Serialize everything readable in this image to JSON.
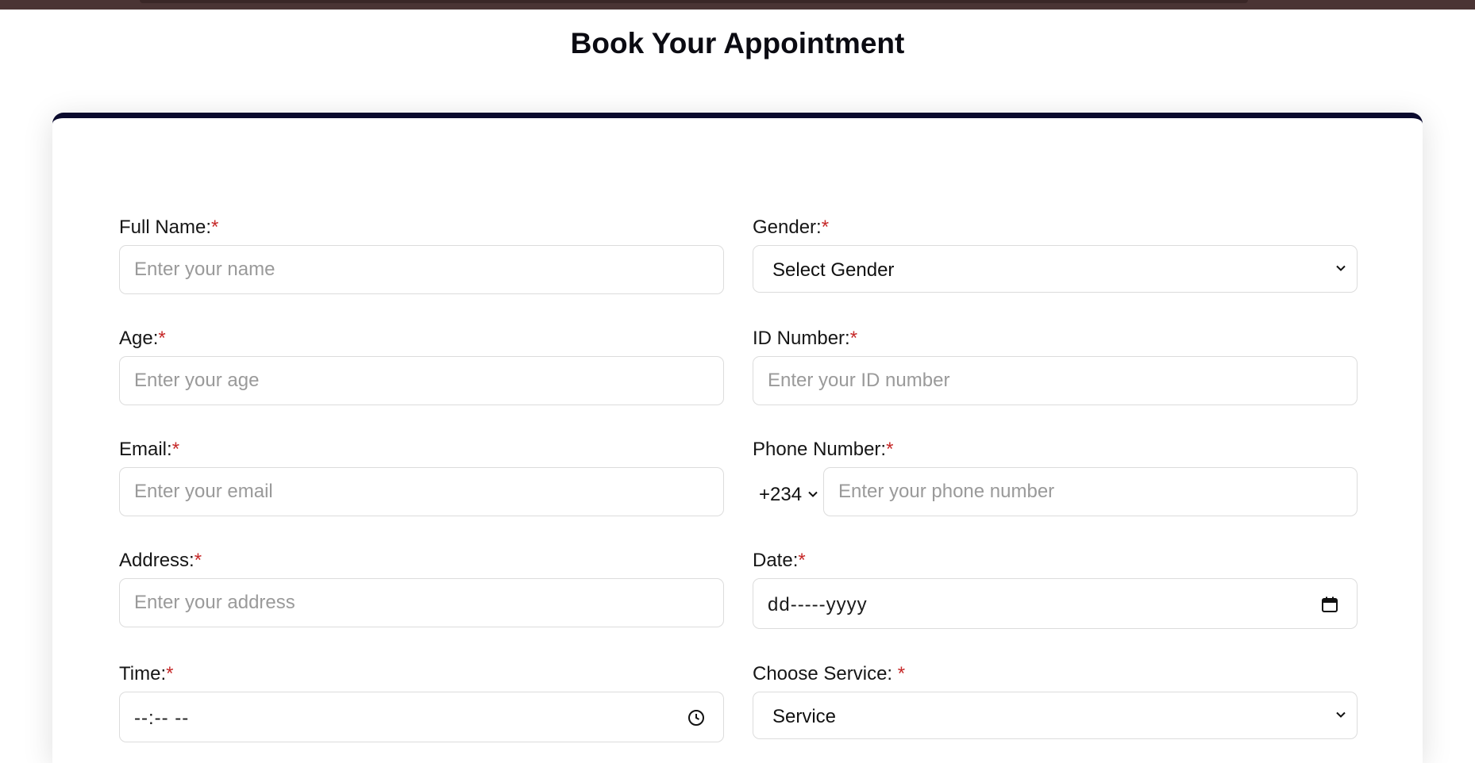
{
  "page": {
    "title": "Book Your Appointment"
  },
  "form": {
    "required_mark": "*",
    "full_name": {
      "label": "Full Name:",
      "placeholder": "Enter your name"
    },
    "gender": {
      "label": "Gender:",
      "selected": "Select Gender"
    },
    "age": {
      "label": "Age:",
      "placeholder": "Enter your age"
    },
    "id_number": {
      "label": "ID Number:",
      "placeholder": "Enter your ID number"
    },
    "email": {
      "label": "Email:",
      "placeholder": "Enter your email"
    },
    "phone": {
      "label": "Phone Number:",
      "country_code": "+234",
      "placeholder": "Enter your phone number"
    },
    "address": {
      "label": "Address:",
      "placeholder": "Enter your address"
    },
    "date": {
      "label": "Date:",
      "value": "dd-----yyyy"
    },
    "time": {
      "label": "Time:",
      "value": "--:-- --"
    },
    "service": {
      "label": "Choose Service: ",
      "selected": "Service"
    }
  },
  "icons": {
    "select_arrow": "chevron-down-icon",
    "date_picker": "calendar-icon",
    "time_picker": "clock-icon"
  },
  "colors": {
    "top_bar": "#4a3434",
    "card_accent": "#0b0b2e",
    "required": "#c62828",
    "placeholder": "#9a9a9a"
  }
}
